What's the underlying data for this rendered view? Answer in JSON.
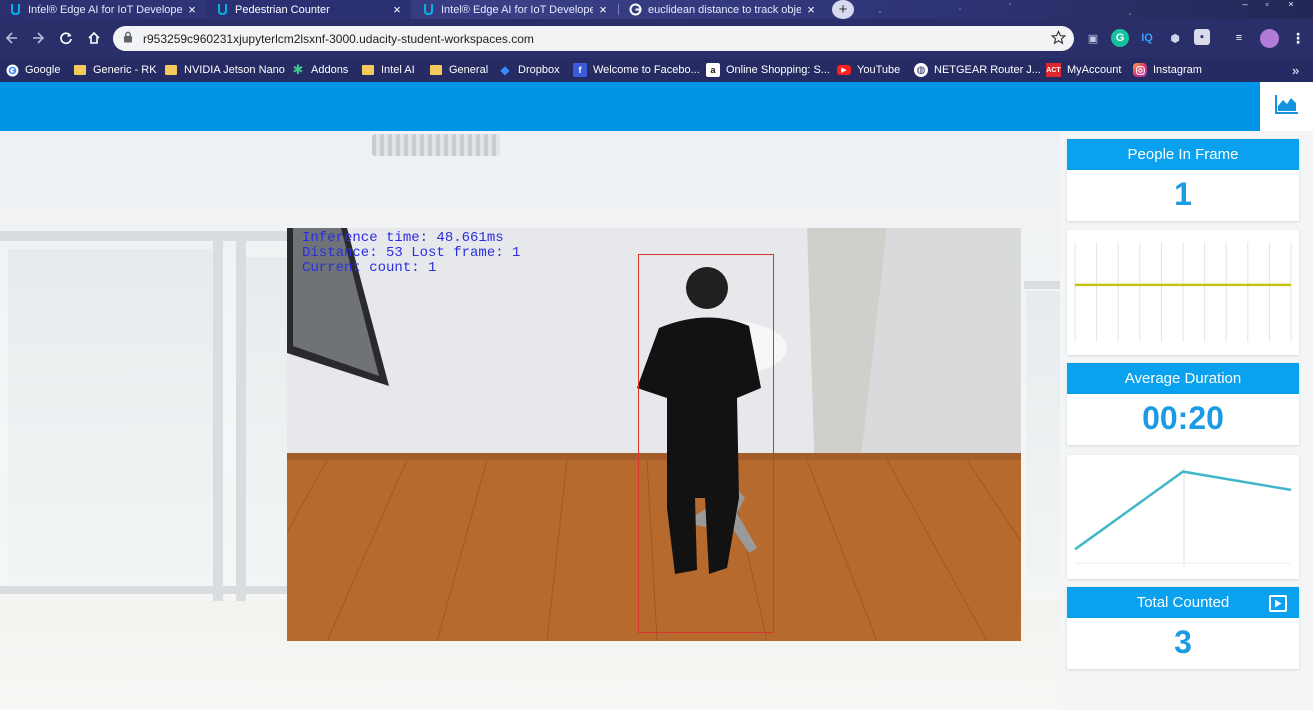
{
  "browser": {
    "tabs": [
      {
        "title": "Intel® Edge AI for IoT Developers",
        "active": false
      },
      {
        "title": "Pedestrian Counter",
        "active": true
      },
      {
        "title": "Intel® Edge AI for IoT Developers",
        "active": false
      },
      {
        "title": "euclidean distance to track objects",
        "active": false
      }
    ],
    "url": "r953259c960231xjupyterlcm2lsxnf-3000.udacity-student-workspaces.com",
    "bookmarks": [
      {
        "label": "Google",
        "icon": "google-icon"
      },
      {
        "label": "Generic - RK",
        "icon": "folder-icon"
      },
      {
        "label": "NVIDIA Jetson Nano",
        "icon": "folder-icon"
      },
      {
        "label": "Addons",
        "icon": "puzzle-icon"
      },
      {
        "label": "Intel AI",
        "icon": "folder-icon"
      },
      {
        "label": "General",
        "icon": "folder-icon"
      },
      {
        "label": "Dropbox",
        "icon": "dropbox-icon"
      },
      {
        "label": "Welcome to Facebo...",
        "icon": "facebook-icon"
      },
      {
        "label": "Online Shopping: S...",
        "icon": "amazon-icon"
      },
      {
        "label": "YouTube",
        "icon": "youtube-icon"
      },
      {
        "label": "NETGEAR Router J...",
        "icon": "globe-icon"
      },
      {
        "label": "MyAccount",
        "icon": "act-icon"
      },
      {
        "label": "Instagram",
        "icon": "instagram-icon"
      }
    ],
    "overflow": "»"
  },
  "video": {
    "inference_line": "Inference time: 48.661ms",
    "distance_line": "Distance: 53 Lost frame: 1",
    "count_line": "Current count: 1"
  },
  "stats": {
    "people_in_frame": {
      "label": "People In Frame",
      "value": "1"
    },
    "average_duration": {
      "label": "Average Duration",
      "value": "00:20"
    },
    "total_counted": {
      "label": "Total Counted",
      "value": "3"
    }
  },
  "colors": {
    "accent": "#0095e6",
    "card_header": "#0aa2ef",
    "value_text": "#1a9be3",
    "people_line": "#c8c414",
    "duration_line": "#42b7c9",
    "bbox": "#e0332c",
    "overlay_text": "#2b2ee0"
  },
  "people_chart": {
    "values": [
      1,
      1,
      1,
      1,
      1,
      1,
      1,
      1,
      1,
      1,
      1
    ]
  },
  "duration_chart": {
    "values": [
      3,
      20,
      16
    ]
  }
}
